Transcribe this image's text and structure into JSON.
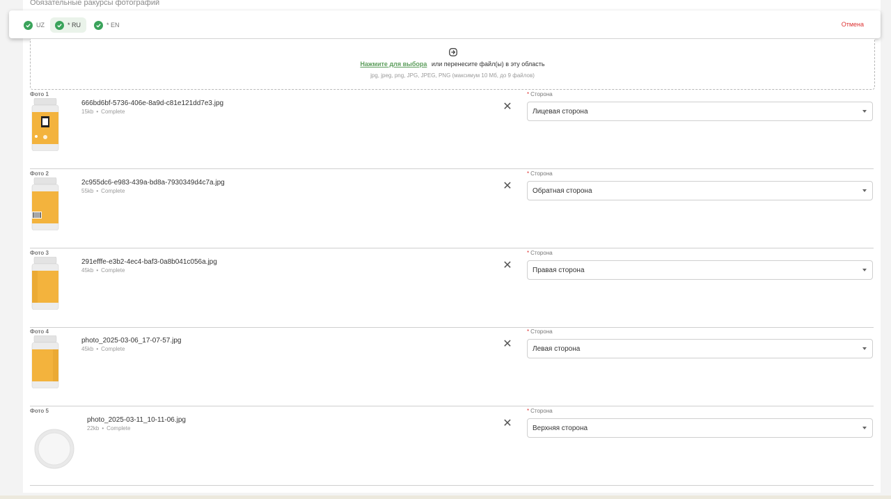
{
  "section_title": "Обязательные ракурсы фотографий",
  "languages": [
    {
      "code": "UZ",
      "prefix": "",
      "active": false
    },
    {
      "code": "RU",
      "prefix": "*",
      "active": true
    },
    {
      "code": "EN",
      "prefix": "*",
      "active": false
    }
  ],
  "cancel_label": "Отмена",
  "upload": {
    "icon": "upload-icon",
    "link_text": "Нажмите для выбора",
    "main_text": "или перенесите файл(ы) в эту область",
    "hint": "jpg, jpeg, png, JPG, JPEG, PNG (максимум 10 Мб, до 9 файлов)"
  },
  "field_label": "Сторона",
  "photos": [
    {
      "label": "Фото 1",
      "file_name": "666bd6bf-5736-406e-8a9d-c81e121dd7e3.jpg",
      "size": "15kb",
      "status": "Complete",
      "side": "Лицевая сторона",
      "thumb": "bottle-front"
    },
    {
      "label": "Фото 2",
      "file_name": "2c955dc6-e983-439a-bd8a-7930349d4c7a.jpg",
      "size": "55kb",
      "status": "Complete",
      "side": "Обратная сторона",
      "thumb": "bottle-back"
    },
    {
      "label": "Фото 3",
      "file_name": "291efffe-e3b2-4ec4-baf3-0a8b041c056a.jpg",
      "size": "45kb",
      "status": "Complete",
      "side": "Правая сторона",
      "thumb": "bottle-side"
    },
    {
      "label": "Фото 4",
      "file_name": "photo_2025-03-06_17-07-57.jpg",
      "size": "45kb",
      "status": "Complete",
      "side": "Левая сторона",
      "thumb": "bottle-side"
    },
    {
      "label": "Фото 5",
      "file_name": "photo_2025-03-11_10-11-06.jpg",
      "size": "22kb",
      "status": "Complete",
      "side": "Верхняя сторона",
      "thumb": "lid-top"
    }
  ],
  "colors": {
    "accent_green": "#3aa35b",
    "cancel_red": "#dd3333",
    "label_orange": "#f3b33d"
  }
}
